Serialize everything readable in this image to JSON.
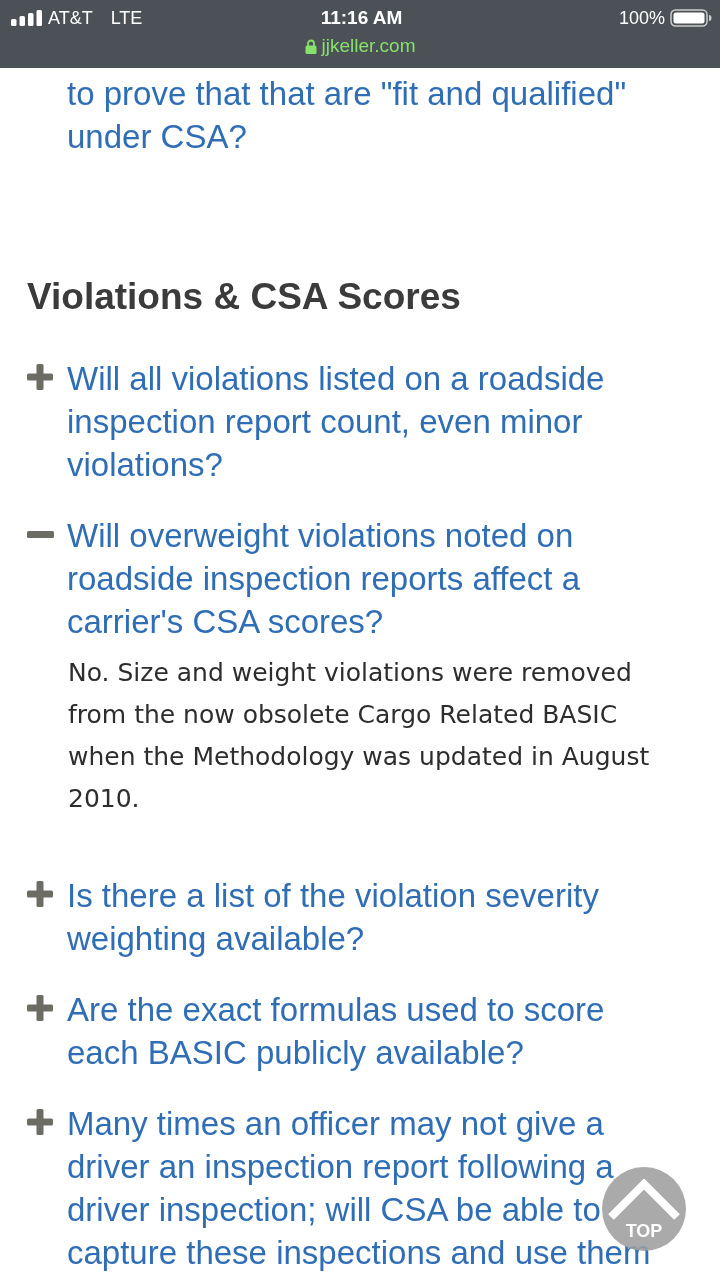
{
  "status_bar": {
    "carrier": "AT&T",
    "network": "LTE",
    "time": "11:16 AM",
    "battery": "100%",
    "url": "jjkeller.com"
  },
  "partial_question": "to prove that that are \"fit and qualified\" under CSA?",
  "section": {
    "title": "Violations & CSA Scores",
    "questions": [
      {
        "question": "Will all violations listed on a roadside inspection report count, even minor violations?",
        "expanded": false
      },
      {
        "question": "Will overweight violations noted on roadside inspection reports affect a carrier's CSA scores?",
        "expanded": true,
        "answer": "No. Size and weight violations were removed from the now obsolete Cargo Related BASIC when the Methodology was updated in August 2010."
      },
      {
        "question": "Is there a list of the violation severity weighting available?",
        "expanded": false
      },
      {
        "question": "Are the exact formulas used to score each BASIC publicly available?",
        "expanded": false
      },
      {
        "question": "Many times an officer may not give a driver an inspection report following a driver inspection; will CSA be able to capture these inspections and use them",
        "expanded": false
      }
    ]
  },
  "top_button": {
    "label": "TOP"
  }
}
